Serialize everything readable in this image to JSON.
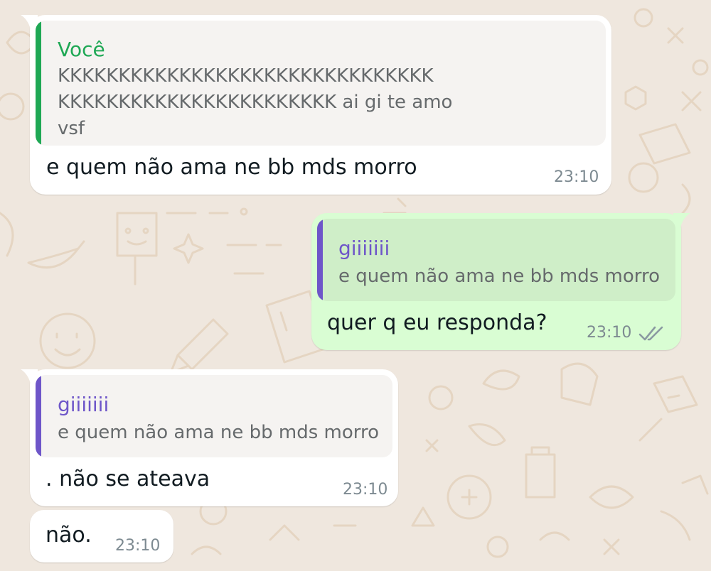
{
  "messages": [
    {
      "direction": "incoming",
      "quote": {
        "author": "Você",
        "author_color": "#1fa855",
        "bar_color": "#1fa855",
        "text": "KKKKKKKKKKKKKKKKKKKKKKKKKKKKKKK KKKKKKKKKKKKKKKKKKKKKKK ai gi te amo vsf"
      },
      "text": "e quem não ama ne bb mds morro",
      "time": "23:10"
    },
    {
      "direction": "outgoing",
      "quote": {
        "author": "giiiiiii",
        "author_color": "#6e56c9",
        "bar_color": "#6e56c9",
        "text": "e quem não ama ne bb mds morro"
      },
      "text": "quer q eu responda?",
      "time": "23:10",
      "status_icon": "double-check-icon"
    },
    {
      "direction": "incoming",
      "quote": {
        "author": "giiiiiii",
        "author_color": "#6e56c9",
        "bar_color": "#6e56c9",
        "text": "e quem não ama ne bb mds morro"
      },
      "text": ". não se ateava",
      "time": "23:10"
    },
    {
      "direction": "incoming",
      "text": "não.",
      "time": "23:10"
    }
  ],
  "colors": {
    "chat_background": "#efe7de",
    "doodle": "#e7d8c6",
    "incoming_bubble": "#ffffff",
    "outgoing_bubble": "#d9fdd3",
    "message_text": "#111b21",
    "timestamp": "#7d8a91"
  }
}
